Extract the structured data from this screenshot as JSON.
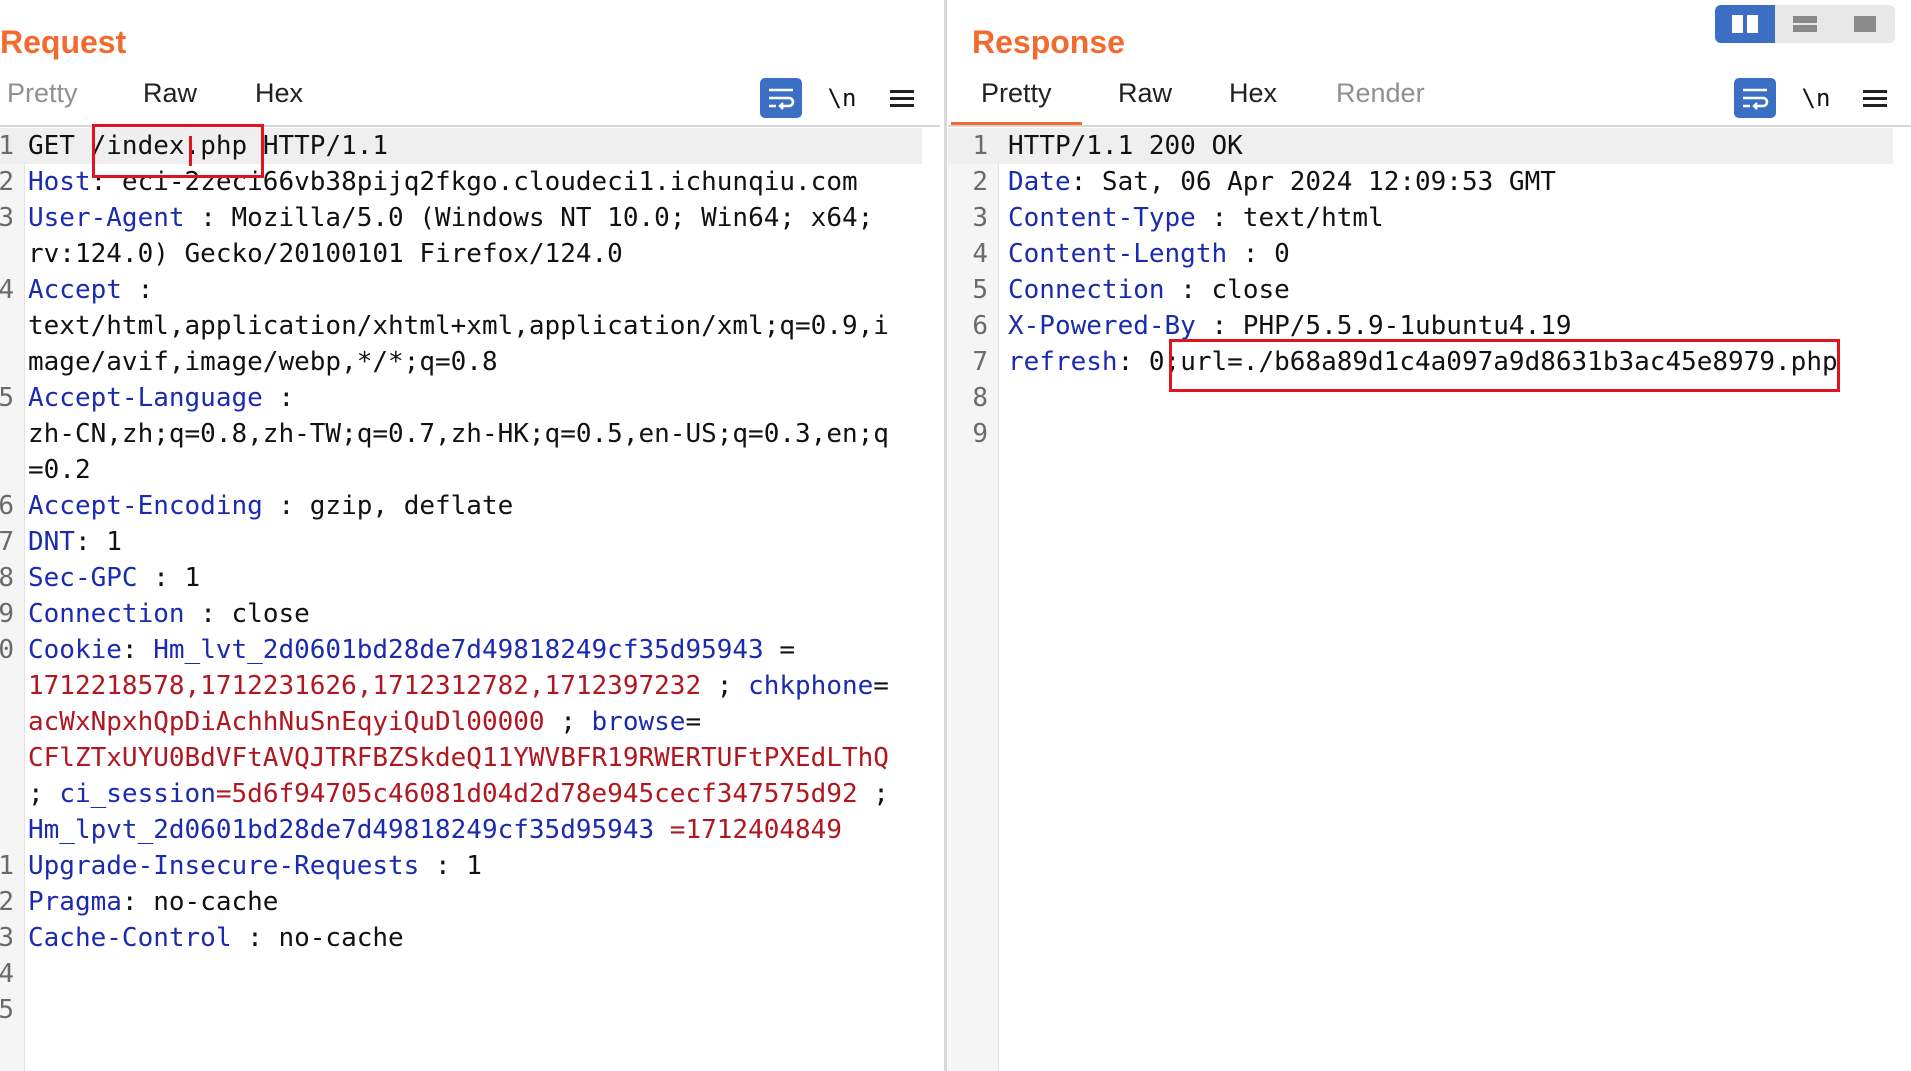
{
  "request": {
    "title": "Request",
    "tabs": [
      "Pretty",
      "Raw",
      "Hex"
    ],
    "newline_label": "\\n",
    "lines": [
      {
        "n": "1",
        "text": "GET /index.php HTTP/1.1",
        "parts": [
          {
            "t": "GET ",
            "c": "v"
          },
          {
            "t": "/index.php",
            "c": "v"
          },
          {
            "t": " HTTP/1.1",
            "c": "v"
          }
        ]
      },
      {
        "n": "2",
        "parts": [
          {
            "t": "Host",
            "c": "k"
          },
          {
            "t": ": eci-2zeci66vb38pijq2fkgo.cloudeci1.ichunqiu.com",
            "c": "v"
          }
        ]
      },
      {
        "n": "3",
        "parts": [
          {
            "t": "User-Agent",
            "c": "k"
          },
          {
            "t": " : Mozilla/5.0 (Windows NT 10.0; Win64; x64;",
            "c": "v"
          }
        ]
      },
      {
        "n": "",
        "parts": [
          {
            "t": "rv:124.0) Gecko/20100101 Firefox/124.0",
            "c": "v"
          }
        ]
      },
      {
        "n": "4",
        "parts": [
          {
            "t": "Accept",
            "c": "k"
          },
          {
            "t": " :",
            "c": "v"
          }
        ]
      },
      {
        "n": "",
        "parts": [
          {
            "t": "text/html,application/xhtml+xml,application/xml;q=0.9,i",
            "c": "v"
          }
        ]
      },
      {
        "n": "",
        "parts": [
          {
            "t": "mage/avif,image/webp,*/*;q=0.8",
            "c": "v"
          }
        ]
      },
      {
        "n": "5",
        "parts": [
          {
            "t": "Accept-Language",
            "c": "k"
          },
          {
            "t": " :",
            "c": "v"
          }
        ]
      },
      {
        "n": "",
        "parts": [
          {
            "t": "zh-CN,zh;q=0.8,zh-TW;q=0.7,zh-HK;q=0.5,en-US;q=0.3,en;q",
            "c": "v"
          }
        ]
      },
      {
        "n": "",
        "parts": [
          {
            "t": "=0.2",
            "c": "v"
          }
        ]
      },
      {
        "n": "6",
        "parts": [
          {
            "t": "Accept-Encoding",
            "c": "k"
          },
          {
            "t": " : gzip, deflate",
            "c": "v"
          }
        ]
      },
      {
        "n": "7",
        "parts": [
          {
            "t": "DNT",
            "c": "k"
          },
          {
            "t": ": 1",
            "c": "v"
          }
        ]
      },
      {
        "n": "8",
        "parts": [
          {
            "t": "Sec-GPC",
            "c": "k"
          },
          {
            "t": " : 1",
            "c": "v"
          }
        ]
      },
      {
        "n": "9",
        "parts": [
          {
            "t": "Connection",
            "c": "k"
          },
          {
            "t": " : close",
            "c": "v"
          }
        ]
      },
      {
        "n": "0",
        "parts": [
          {
            "t": "Cookie",
            "c": "k"
          },
          {
            "t": ": ",
            "c": "v"
          },
          {
            "t": "Hm_lvt_2d0601bd28de7d49818249cf35d95943",
            "c": "k"
          },
          {
            "t": " =",
            "c": "v"
          }
        ]
      },
      {
        "n": "",
        "parts": [
          {
            "t": "1712218578,1712231626,1712312782,1712397232",
            "c": "r"
          },
          {
            "t": " ; ",
            "c": "v"
          },
          {
            "t": "chkphone",
            "c": "k"
          },
          {
            "t": "=",
            "c": "v"
          }
        ]
      },
      {
        "n": "",
        "parts": [
          {
            "t": "acWxNpxhQpDiAchhNuSnEqyiQuDl00000",
            "c": "r"
          },
          {
            "t": " ; ",
            "c": "v"
          },
          {
            "t": "browse",
            "c": "k"
          },
          {
            "t": "=",
            "c": "v"
          }
        ]
      },
      {
        "n": "",
        "parts": [
          {
            "t": "CFlZTxUYU0BdVFtAVQJTRFBZSkdeQ11YWVBFR19RWERTUFtPXEdLThQ",
            "c": "r"
          }
        ]
      },
      {
        "n": "",
        "parts": [
          {
            "t": "; ",
            "c": "v"
          },
          {
            "t": "ci_session",
            "c": "k"
          },
          {
            "t": "=5d6f94705c46081d04d2d78e945cecf347575d92",
            "c": "r"
          },
          {
            "t": " ;",
            "c": "v"
          }
        ]
      },
      {
        "n": "",
        "parts": [
          {
            "t": "Hm_lpvt_2d0601bd28de7d49818249cf35d95943",
            "c": "k"
          },
          {
            "t": " =1712404849",
            "c": "r"
          }
        ]
      },
      {
        "n": "1",
        "parts": [
          {
            "t": "Upgrade-Insecure-Requests",
            "c": "k"
          },
          {
            "t": " : 1",
            "c": "v"
          }
        ]
      },
      {
        "n": "2",
        "parts": [
          {
            "t": "Pragma",
            "c": "k"
          },
          {
            "t": ": no-cache",
            "c": "v"
          }
        ]
      },
      {
        "n": "3",
        "parts": [
          {
            "t": "Cache-Control",
            "c": "k"
          },
          {
            "t": " : no-cache",
            "c": "v"
          }
        ]
      },
      {
        "n": "4",
        "parts": []
      },
      {
        "n": "5",
        "parts": []
      }
    ]
  },
  "response": {
    "title": "Response",
    "tabs": [
      "Pretty",
      "Raw",
      "Hex",
      "Render"
    ],
    "newline_label": "\\n",
    "lines": [
      {
        "n": "1",
        "parts": [
          {
            "t": "HTTP/1.1 200 OK",
            "c": "v"
          }
        ]
      },
      {
        "n": "2",
        "parts": [
          {
            "t": "Date",
            "c": "k"
          },
          {
            "t": ": Sat, 06 Apr 2024 12:09:53 GMT",
            "c": "v"
          }
        ]
      },
      {
        "n": "3",
        "parts": [
          {
            "t": "Content-Type",
            "c": "k"
          },
          {
            "t": " : text/html",
            "c": "v"
          }
        ]
      },
      {
        "n": "4",
        "parts": [
          {
            "t": "Content-Length",
            "c": "k"
          },
          {
            "t": " : 0",
            "c": "v"
          }
        ]
      },
      {
        "n": "5",
        "parts": [
          {
            "t": "Connection",
            "c": "k"
          },
          {
            "t": " : close",
            "c": "v"
          }
        ]
      },
      {
        "n": "6",
        "parts": [
          {
            "t": "X-Powered-By",
            "c": "k"
          },
          {
            "t": " : PHP/5.5.9-1ubuntu4.19",
            "c": "v"
          }
        ]
      },
      {
        "n": "7",
        "parts": [
          {
            "t": "refresh",
            "c": "k"
          },
          {
            "t": ": 0;url=./b68a89d1c4a097a9d8631b3ac45e8979.php",
            "c": "v"
          }
        ]
      },
      {
        "n": "8",
        "parts": []
      },
      {
        "n": "9",
        "parts": []
      }
    ]
  },
  "colors": {
    "accent": "#f26a2d",
    "header_key": "#1a2bb0",
    "cookie_value": "#b0171f",
    "button_blue": "#3a6fc4",
    "highlight_box": "#e0141e"
  }
}
